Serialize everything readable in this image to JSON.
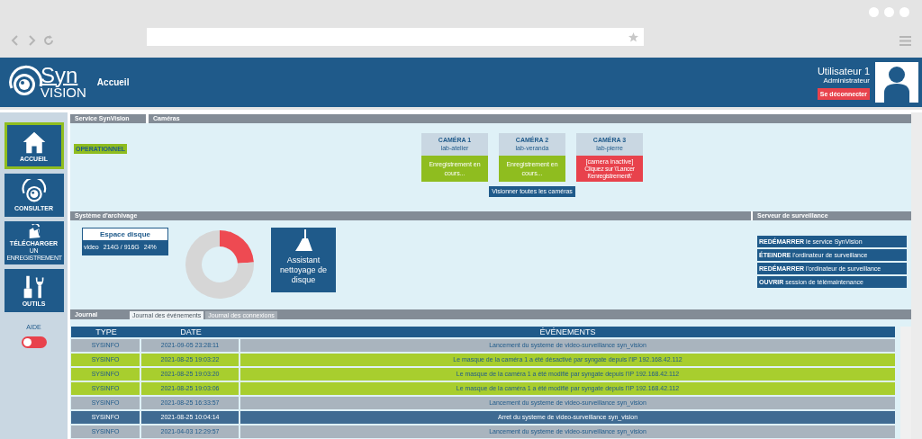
{
  "logo": {
    "top": "Syn",
    "bottom": "VISION"
  },
  "page_title": "Accueil",
  "user": {
    "name": "Utilisateur 1",
    "role": "Administrateur",
    "logout": "Se déconnecter"
  },
  "nav": [
    {
      "label": "ACCUEIL",
      "selected": true
    },
    {
      "label": "CONSULTER",
      "selected": false
    },
    {
      "label": "TÉLÉCHARGER",
      "sublabel": "UN ENREGISTREMENT",
      "selected": false
    },
    {
      "label": "OUTILS",
      "selected": false
    }
  ],
  "help": {
    "label": "AIDE",
    "on": false
  },
  "service": {
    "title": "Service SynVision",
    "status": "OPERATIONNEL"
  },
  "cameras": {
    "title": "Caméras",
    "view_all": "Visionner toutes les caméras",
    "items": [
      {
        "name": "CAMÉRA 1",
        "host": "lab-atelier",
        "kind": "recording",
        "status": "Enregistrement en cours..."
      },
      {
        "name": "CAMÉRA 2",
        "host": "lab-veranda",
        "kind": "recording",
        "status": "Enregistrement en cours..."
      },
      {
        "name": "CAMÉRA 3",
        "host": "lab-pierre",
        "kind": "inactive",
        "status": "[camera inactive]",
        "hint": "Cliquez sur \\'Lancer l\\'enregistrement\\'"
      }
    ]
  },
  "archive": {
    "title": "Système d'archivage",
    "disk": {
      "title": "Espace disque",
      "volume": "video",
      "usage": "214G / 916G",
      "percent": "24%"
    },
    "chart_data": {
      "type": "donut",
      "values": [
        24,
        76
      ]
    },
    "cleanup": "Assistant nettoyage de disque"
  },
  "server": {
    "title": "Serveur de surveillance",
    "actions": [
      "**REDÉMARRER** le service SynVision",
      "**ÉTEINDRE** l'ordinateur de surveillance",
      "**REDÉMARRER** l'ordinateur de surveillance",
      "**OUVRIR** session de télémaintenance"
    ]
  },
  "journal": {
    "title": "Journal",
    "tabs": [
      {
        "label": "Journal des événements",
        "selected": true
      },
      {
        "label": "Journal des connexions",
        "selected": false
      }
    ],
    "columns": [
      "TYPE",
      "DATE",
      "ÉVÉNEMENTS"
    ],
    "rows": [
      {
        "kind": "info",
        "type": "SYSINFO",
        "date": "2021-09-05 23:28:11",
        "event": "Lancement du systeme de video-surveillance syn_vision"
      },
      {
        "kind": "mask",
        "type": "SYSINFO",
        "date": "2021-08-25 19:03:22",
        "event": "Le masque de la caméra 1 a été désactivé par syngate depuis l'IP 192.168.42.112"
      },
      {
        "kind": "mask",
        "type": "SYSINFO",
        "date": "2021-08-25 19:03:20",
        "event": "Le masque de la caméra 1 a été modifié par syngate depuis l'IP 192.168.42.112"
      },
      {
        "kind": "mask",
        "type": "SYSINFO",
        "date": "2021-08-25 19:03:06",
        "event": "Le masque de la caméra 1 a été modifié par syngate depuis l'IP 192.168.42.112"
      },
      {
        "kind": "info",
        "type": "SYSINFO",
        "date": "2021-08-25 16:33:57",
        "event": "Lancement du systeme de video-surveillance syn_vision"
      },
      {
        "kind": "stop",
        "type": "SYSINFO",
        "date": "2021-08-25 10:04:14",
        "event": "Arret du systeme de video-surveillance syn_vision"
      },
      {
        "kind": "info",
        "type": "SYSINFO",
        "date": "2021-04-03 12:29:57",
        "event": "Lancement du systeme de video-surveillance syn_vision"
      }
    ]
  }
}
